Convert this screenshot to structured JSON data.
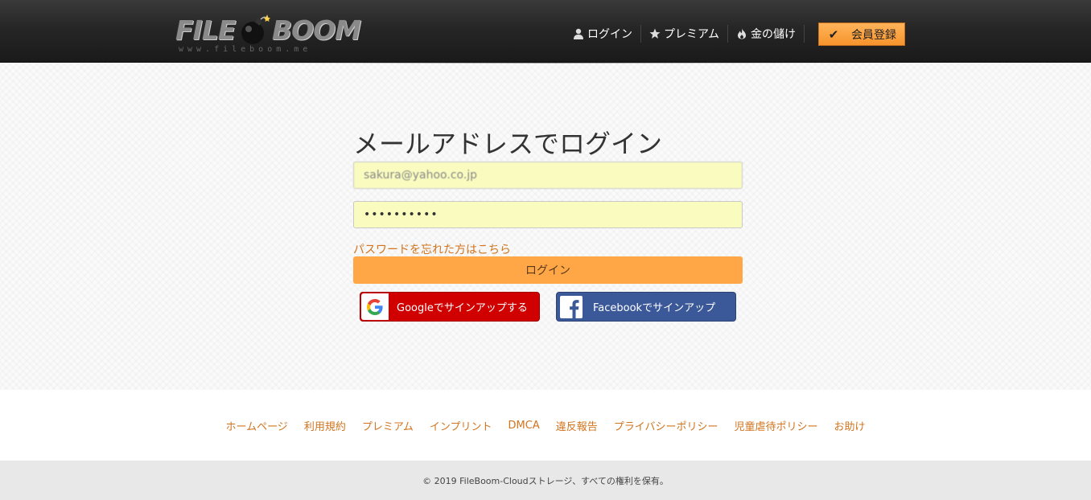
{
  "header": {
    "logo": {
      "word1": "FILE",
      "word2": "BOOM",
      "url": "www.fileboom.me"
    },
    "nav": [
      {
        "label": "ログイン",
        "icon": "user-icon"
      },
      {
        "label": "プレミアム",
        "icon": "star-icon"
      },
      {
        "label": "金の儲け",
        "icon": "flame-icon"
      }
    ],
    "signup": {
      "label": "会員登録",
      "icon": "checkmark-icon"
    }
  },
  "login": {
    "title": "メールアドレスでログイン",
    "email_value": "sakura@yahoo.co.jp",
    "password_value": "••••••••••",
    "forgot_label": "パスワードを忘れた方はこちら",
    "submit_label": "ログイン",
    "google_label": "Googleでサインアップする",
    "facebook_label": "Facebookでサインアップ"
  },
  "footer": {
    "links": [
      "ホームページ",
      "利用規約",
      "プレミアム",
      "インプリント",
      "DMCA",
      "違反報告",
      "プライバシーポリシー",
      "児童虐待ポリシー",
      "お助け"
    ],
    "copyright": "© 2019 FileBoom-Cloudストレージ、すべての権利を保有。"
  },
  "colors": {
    "accent_orange": "#ffa646",
    "link_orange": "#d2741e",
    "google_red": "#d10000",
    "facebook_blue": "#3b5998",
    "input_yellow": "#fafcbf"
  }
}
